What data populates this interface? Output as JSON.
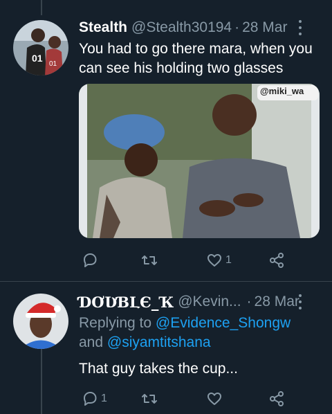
{
  "tweets": [
    {
      "name": "Stealth",
      "handle": "@Stealth30194",
      "separator": "·",
      "time": "28 Mar",
      "text": "You had to go there mara, when you can see his holding two glasses",
      "media_watermark": "@miki_wa",
      "actions": {
        "reply_count": "",
        "retweet_count": "",
        "like_count": "1"
      }
    },
    {
      "name": "ƊƠƲƁԼЄ_Ҡ",
      "handle": "@Kevin...",
      "separator": "·",
      "time": "28 Mar",
      "replying_prefix": "Replying to",
      "replying_user_1": "@Evidence_Shongw",
      "replying_and": "and",
      "replying_user_2": "@siyamtitshana",
      "text": "That guy takes the cup...",
      "actions": {
        "reply_count": "1",
        "retweet_count": "",
        "like_count": ""
      }
    }
  ],
  "icons": [
    "more-icon",
    "reply-icon",
    "retweet-icon",
    "like-icon",
    "share-icon"
  ],
  "colors": {
    "background": "#15202b",
    "muted": "#8899a6",
    "link": "#1da1f2",
    "divider": "#38444d"
  }
}
